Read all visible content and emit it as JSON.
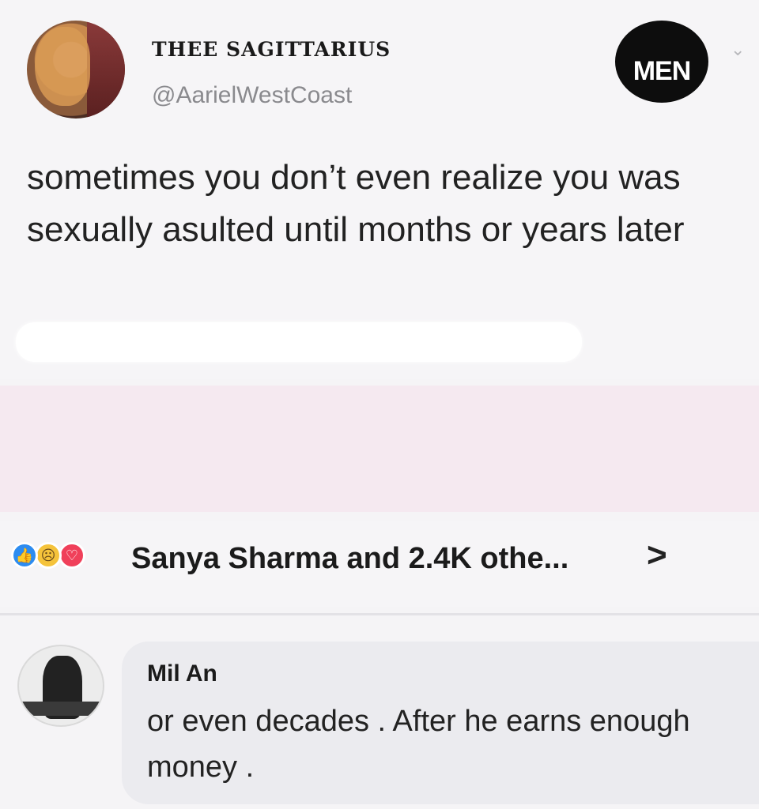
{
  "post": {
    "display_name": "THEE SAGITTARIUS",
    "handle": "@AarielWestCoast",
    "text": "sometimes you don’t even realize you was sexually asulted until months or years later",
    "logo_text": "MEN",
    "avatar_icon": "profile-photo"
  },
  "reactions": {
    "icons": [
      "like",
      "sad",
      "love"
    ],
    "summary": "Sanya Sharma and 2.4K othe...",
    "chevron": ">"
  },
  "comment": {
    "author": "Mil An",
    "text": "or even decades . After he earns enough money ."
  },
  "colors": {
    "background": "#f5f4f6",
    "pink_band": "#f5e9f0",
    "bubble": "#ebebef",
    "like": "#2d8cf0",
    "sad": "#f5c33b",
    "love": "#f0405a"
  }
}
